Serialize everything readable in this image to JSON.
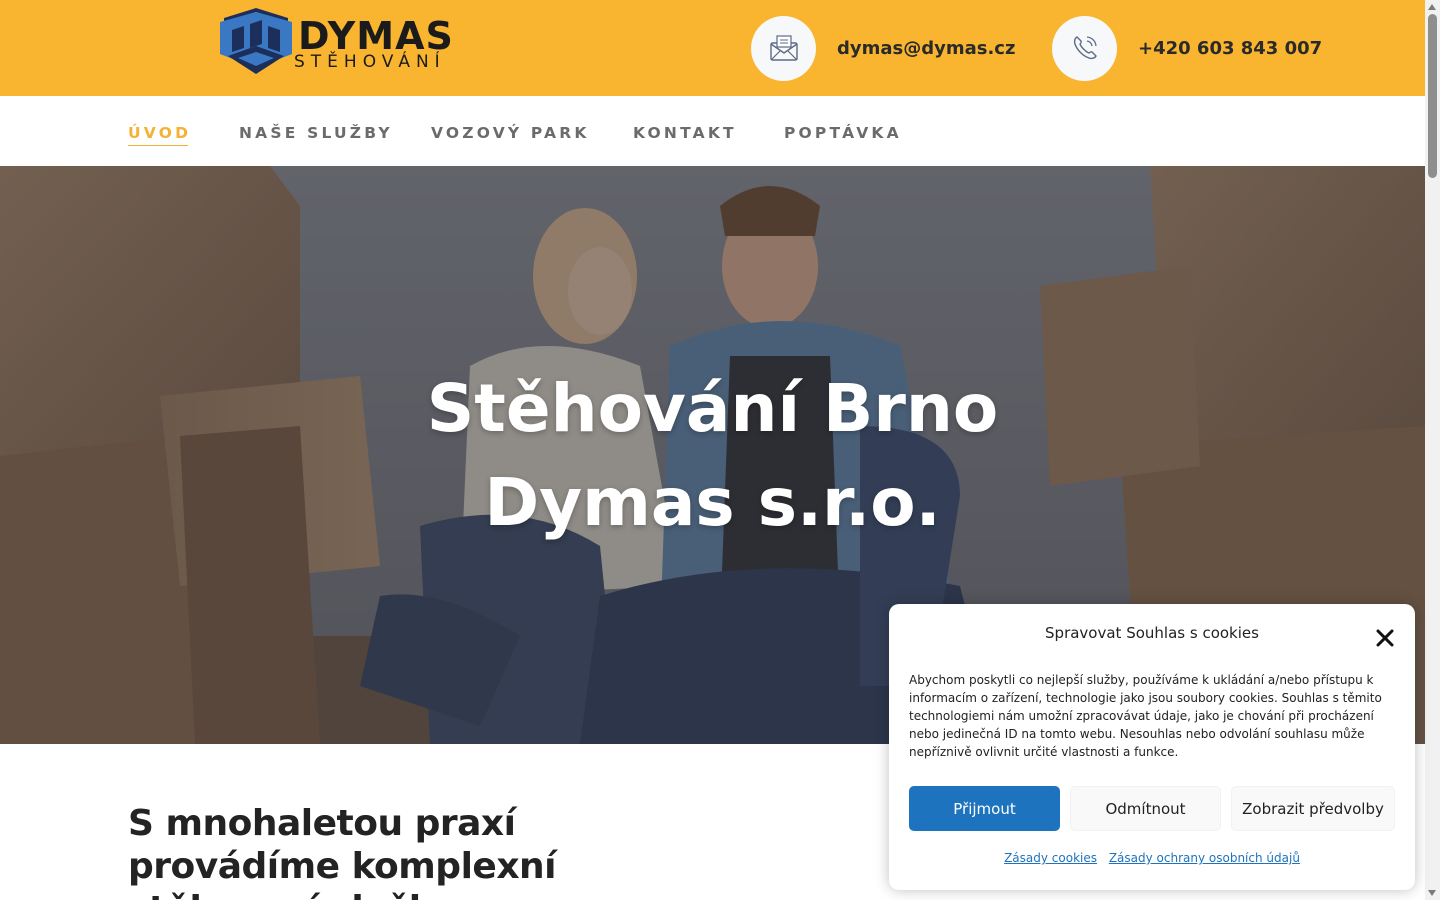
{
  "brand": {
    "name": "DYMAS",
    "tagline": "STĚHOVÁNÍ",
    "colors": {
      "accent": "#f9b530",
      "logo_blue": "#3b78c4",
      "logo_dark": "#1b2f5a"
    }
  },
  "header": {
    "email": {
      "icon": "envelope-icon",
      "text": "dymas@dymas.cz"
    },
    "phone": {
      "icon": "phone-icon",
      "text": "+420 603 843 007"
    }
  },
  "nav": {
    "items": [
      {
        "label": "ÚVOD",
        "active": true
      },
      {
        "label": "NAŠE SLUŽBY",
        "active": false
      },
      {
        "label": "VOZOVÝ PARK",
        "active": false
      },
      {
        "label": "KONTAKT",
        "active": false
      },
      {
        "label": "POPTÁVKA",
        "active": false
      }
    ]
  },
  "hero": {
    "title_line1": "Stěhování Brno",
    "title_line2": "Dymas s.r.o."
  },
  "intro": {
    "line1": "S mnohaletou praxí",
    "line2": "provádíme komplexní",
    "line3": "stěhovací služby"
  },
  "cookie": {
    "title": "Spravovat Souhlas s cookies",
    "close_icon": "close-icon",
    "body": "Abychom poskytli co nejlepší služby, používáme k ukládání a/nebo přístupu k informacím o zařízení, technologie jako jsou soubory cookies. Souhlas s těmito technologiemi nám umožní zpracovávat údaje, jako je chování při procházení nebo jedinečná ID na tomto webu. Nesouhlas nebo odvolání souhlasu může nepříznivě ovlivnit určité vlastnosti a funkce.",
    "accept_label": "Přijmout",
    "deny_label": "Odmítnout",
    "prefs_label": "Zobrazit předvolby",
    "link_cookies": "Zásady cookies",
    "link_privacy": "Zásady ochrany osobních údajů",
    "colors": {
      "primary": "#1e73be"
    }
  }
}
